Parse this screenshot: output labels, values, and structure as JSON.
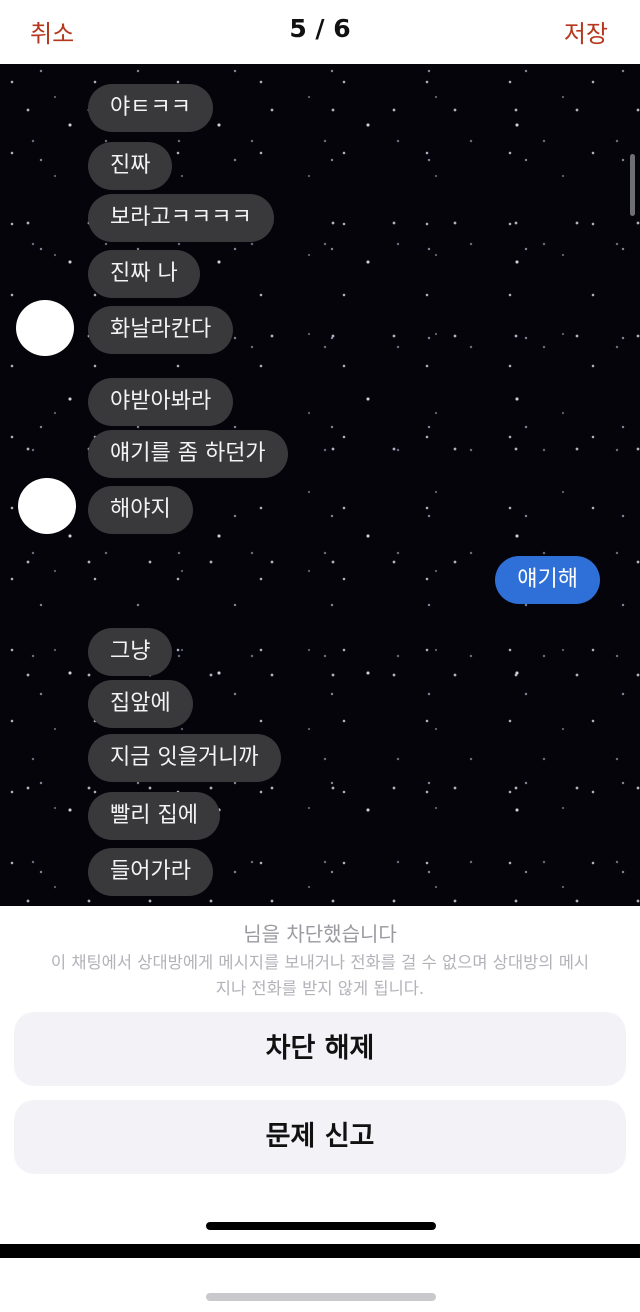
{
  "topbar": {
    "cancel_label": "취소",
    "counter": "5 / 6",
    "save_label": "저장"
  },
  "chat": {
    "messages": [
      {
        "text": "야ㅌㅋㅋ",
        "sender": "other"
      },
      {
        "text": "진짜",
        "sender": "other"
      },
      {
        "text": "보라고ㅋㅋㅋㅋ",
        "sender": "other"
      },
      {
        "text": "진짜 나",
        "sender": "other"
      },
      {
        "text": "화날라칸다",
        "sender": "other"
      },
      {
        "text": "야받아봐라",
        "sender": "other"
      },
      {
        "text": "얘기를 좀 하던가",
        "sender": "other"
      },
      {
        "text": "해야지",
        "sender": "other"
      },
      {
        "text": "얘기해",
        "sender": "me"
      },
      {
        "text": "그냥",
        "sender": "other"
      },
      {
        "text": "집앞에",
        "sender": "other"
      },
      {
        "text": "지금 잇을거니까",
        "sender": "other"
      },
      {
        "text": "빨리 집에",
        "sender": "other"
      },
      {
        "text": "들어가라",
        "sender": "other"
      }
    ]
  },
  "sheet": {
    "title": "님을 차단했습니다",
    "description": "이 채팅에서 상대방에게 메시지를 보내거나 전화를 걸 수 없으며 상대방의 메시지나 전화를 받지 않게 됩니다.",
    "unblock_label": "차단 해제",
    "report_label": "문제 신고"
  },
  "colors": {
    "accent": "#b5371d",
    "my_bubble": "#2f6fd8",
    "other_bubble": "#39393c",
    "chat_background": "#04040a"
  }
}
